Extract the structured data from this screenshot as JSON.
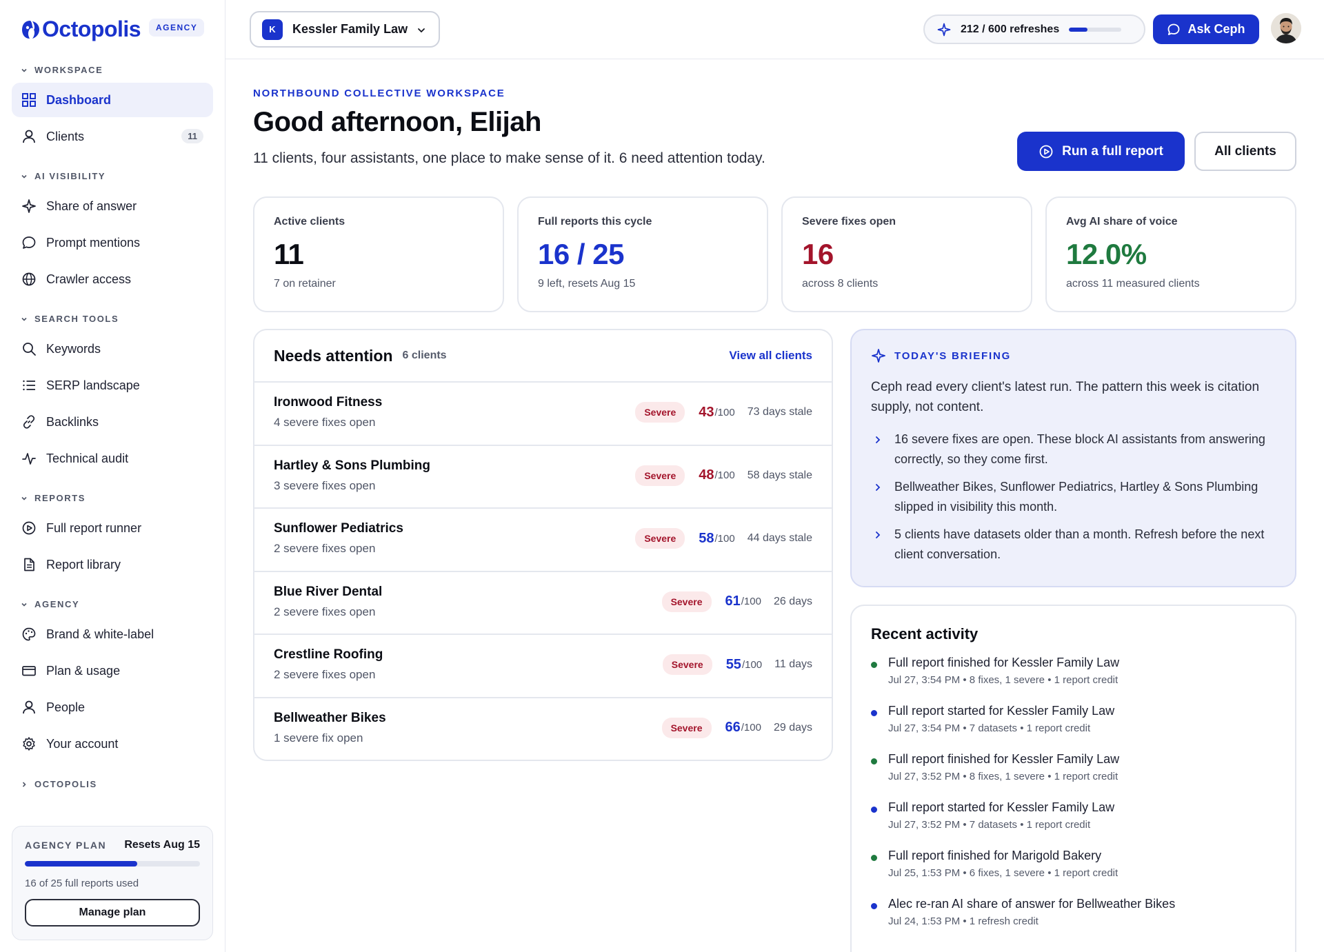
{
  "brand": {
    "name": "Octopolis",
    "badge": "AGENCY"
  },
  "sidebar": {
    "sections": {
      "workspace": "WORKSPACE",
      "ai_visibility": "AI VISIBILITY",
      "search_tools": "SEARCH TOOLS",
      "reports": "REPORTS",
      "agency": "AGENCY",
      "octopolis": "OCTOPOLIS"
    },
    "items": {
      "dashboard": "Dashboard",
      "clients": "Clients",
      "clients_count": "11",
      "share_of_answer": "Share of answer",
      "prompt_mentions": "Prompt mentions",
      "crawler_access": "Crawler access",
      "keywords": "Keywords",
      "serp_landscape": "SERP landscape",
      "backlinks": "Backlinks",
      "technical_audit": "Technical audit",
      "full_report_runner": "Full report runner",
      "report_library": "Report library",
      "brand_white_label": "Brand & white-label",
      "plan_usage": "Plan & usage",
      "people": "People",
      "your_account": "Your account"
    },
    "plan": {
      "label": "AGENCY PLAN",
      "resets": "Resets Aug 15",
      "used_text": "16 of 25 full reports used",
      "used_fraction": 0.64,
      "button": "Manage plan"
    }
  },
  "topbar": {
    "client_initial": "K",
    "client_name": "Kessler Family Law",
    "refreshes": "212 / 600 refreshes",
    "refresh_fraction": 0.353,
    "ask_button": "Ask Ceph"
  },
  "main": {
    "eyebrow": "NORTHBOUND COLLECTIVE WORKSPACE",
    "greeting": "Good afternoon, Elijah",
    "subline": "11 clients, four assistants, one place to make sense of it. 6 need attention today.",
    "run_button": "Run a full report",
    "all_button": "All clients",
    "stats": [
      {
        "label": "Active clients",
        "value": "11",
        "note": "7 on retainer",
        "color": "#0b0d14"
      },
      {
        "label": "Full reports this cycle",
        "value": "16 / 25",
        "note": "9 left, resets Aug 15",
        "color": "#1a33cc"
      },
      {
        "label": "Severe fixes open",
        "value": "16",
        "note": "across 8 clients",
        "color": "#a3142b"
      },
      {
        "label": "Avg AI share of voice",
        "value": "12.0%",
        "note": "across 11 measured clients",
        "color": "#1f7a3f"
      }
    ],
    "attention": {
      "title": "Needs attention",
      "count": "6 clients",
      "view_all": "View all clients",
      "rows": [
        {
          "name": "Ironwood Fitness",
          "sub": "4 severe fixes open",
          "badge": "Severe",
          "score": "43",
          "denom": "/100",
          "stale": "73 days stale",
          "score_color": "#a3142b"
        },
        {
          "name": "Hartley & Sons Plumbing",
          "sub": "3 severe fixes open",
          "badge": "Severe",
          "score": "48",
          "denom": "/100",
          "stale": "58 days stale",
          "score_color": "#a3142b"
        },
        {
          "name": "Sunflower Pediatrics",
          "sub": "2 severe fixes open",
          "badge": "Severe",
          "score": "58",
          "denom": "/100",
          "stale": "44 days stale",
          "score_color": "#1a33cc"
        },
        {
          "name": "Blue River Dental",
          "sub": "2 severe fixes open",
          "badge": "Severe",
          "score": "61",
          "denom": "/100",
          "stale": "26 days",
          "score_color": "#1a33cc"
        },
        {
          "name": "Crestline Roofing",
          "sub": "2 severe fixes open",
          "badge": "Severe",
          "score": "55",
          "denom": "/100",
          "stale": "11 days",
          "score_color": "#1a33cc"
        },
        {
          "name": "Bellweather Bikes",
          "sub": "1 severe fix open",
          "badge": "Severe",
          "score": "66",
          "denom": "/100",
          "stale": "29 days",
          "score_color": "#1a33cc"
        }
      ]
    },
    "briefing": {
      "label": "TODAY'S BRIEFING",
      "intro": "Ceph read every client's latest run. The pattern this week is citation supply, not content.",
      "items": [
        "16 severe fixes are open. These block AI assistants from answering correctly, so they come first.",
        "Bellweather Bikes, Sunflower Pediatrics, Hartley & Sons Plumbing slipped in visibility this month.",
        "5 clients have datasets older than a month. Refresh before the next client conversation."
      ]
    },
    "activity": {
      "title": "Recent activity",
      "items": [
        {
          "text": "Full report finished for Kessler Family Law",
          "meta": "Jul 27, 3:54 PM • 8 fixes, 1 severe • 1 report credit",
          "dot": "#1f7a3f"
        },
        {
          "text": "Full report started for Kessler Family Law",
          "meta": "Jul 27, 3:54 PM • 7 datasets • 1 report credit",
          "dot": "#1a33cc"
        },
        {
          "text": "Full report finished for Kessler Family Law",
          "meta": "Jul 27, 3:52 PM • 8 fixes, 1 severe • 1 report credit",
          "dot": "#1f7a3f"
        },
        {
          "text": "Full report started for Kessler Family Law",
          "meta": "Jul 27, 3:52 PM • 7 datasets • 1 report credit",
          "dot": "#1a33cc"
        },
        {
          "text": "Full report finished for Marigold Bakery",
          "meta": "Jul 25, 1:53 PM • 6 fixes, 1 severe • 1 report credit",
          "dot": "#1f7a3f"
        },
        {
          "text": "Alec re-ran AI share of answer for Bellweather Bikes",
          "meta": "Jul 24, 1:53 PM • 1 refresh credit",
          "dot": "#1a33cc"
        }
      ]
    }
  }
}
